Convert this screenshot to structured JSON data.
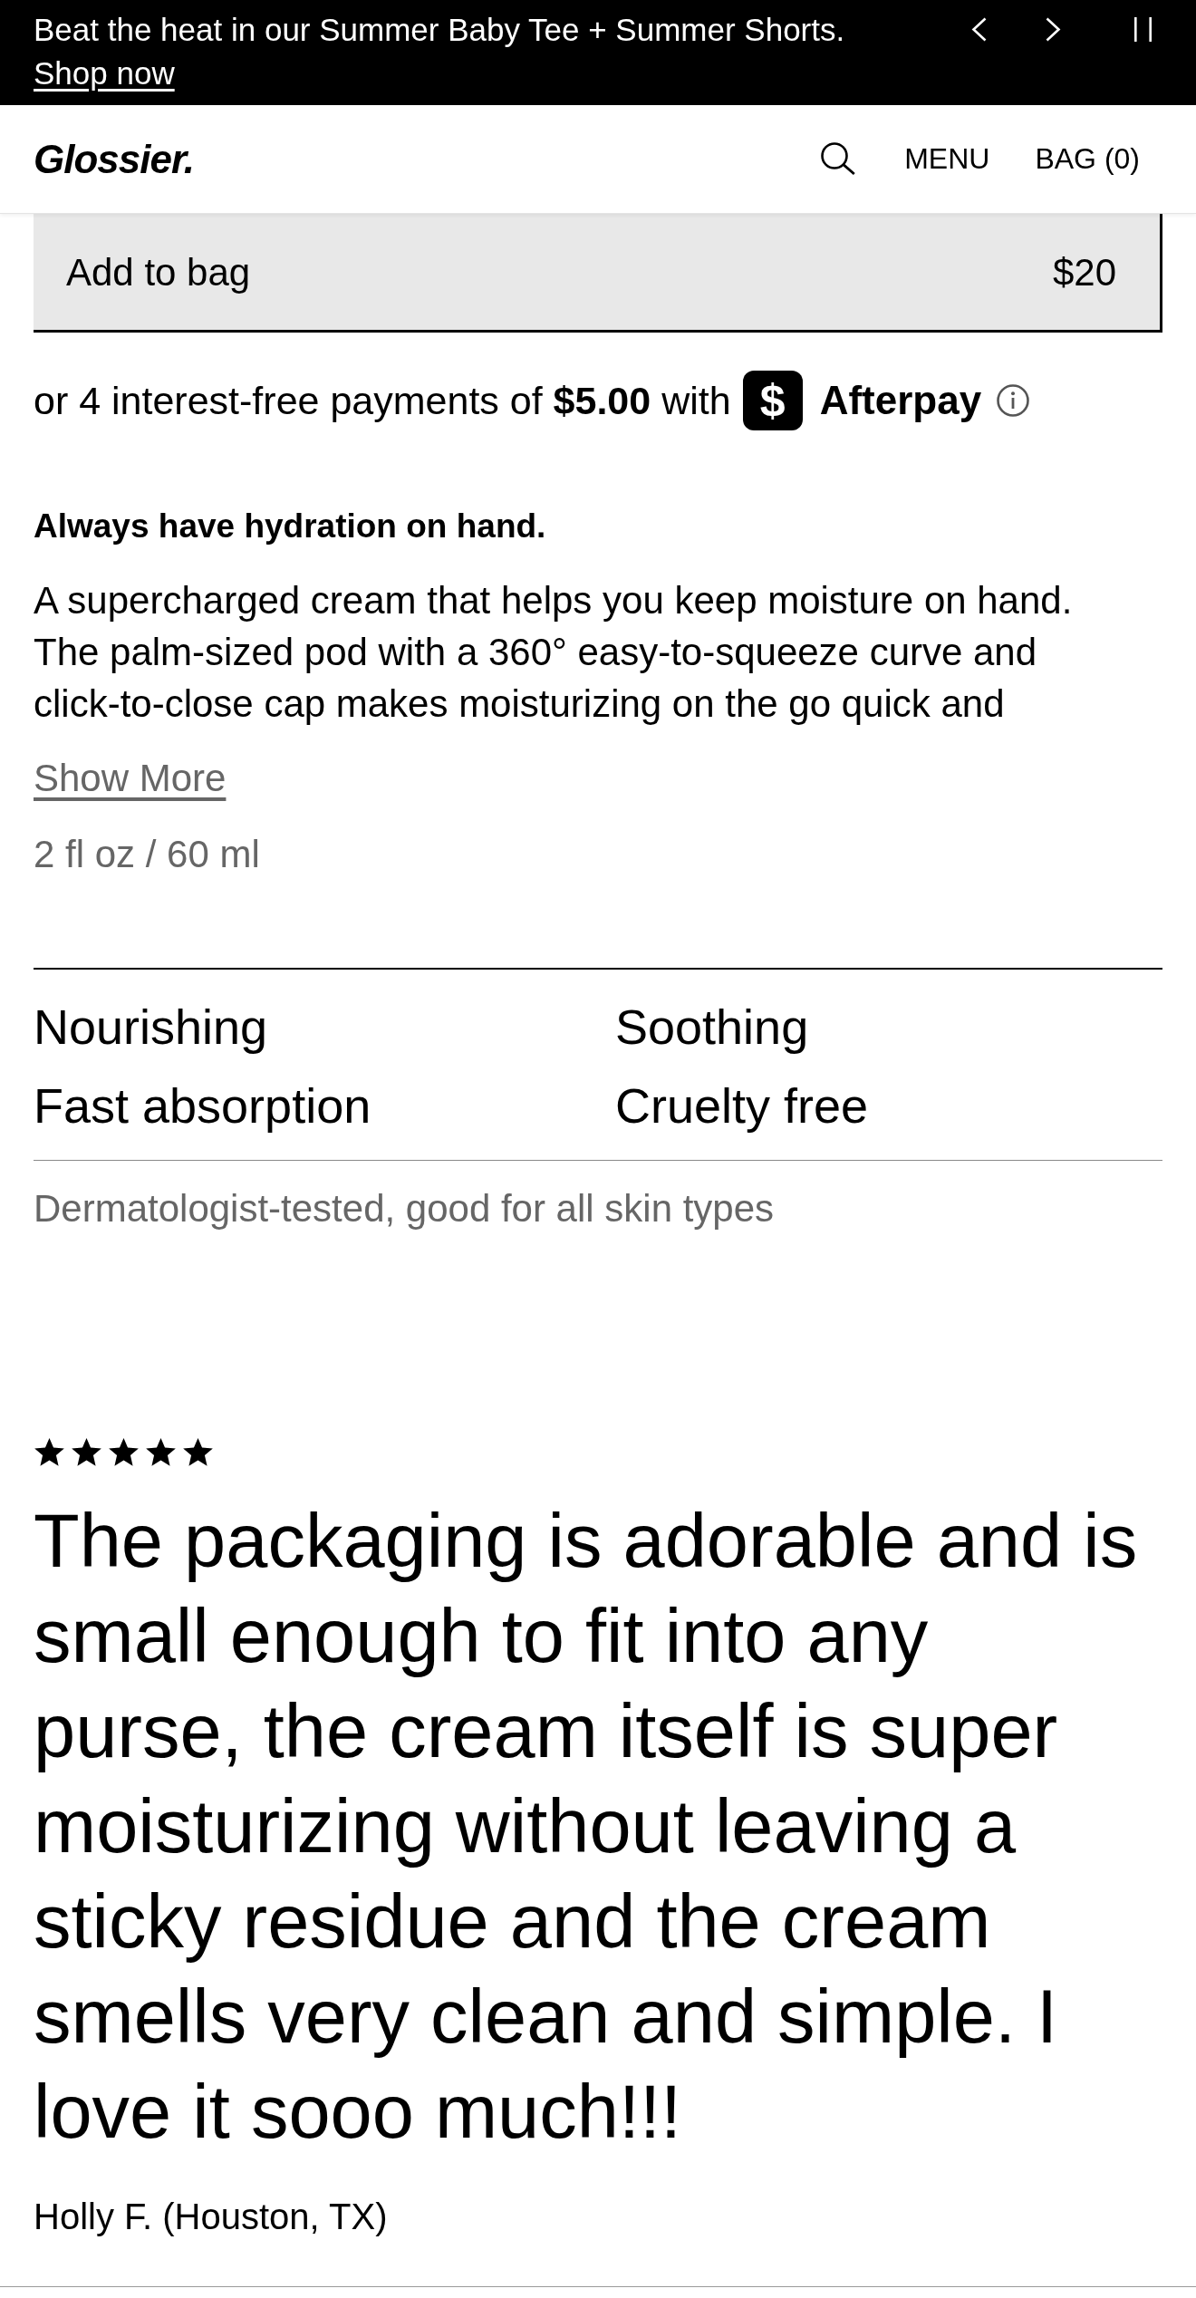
{
  "announcement": {
    "message": "Beat the heat in our Summer Baby Tee + Summer Shorts.",
    "link": "Shop now"
  },
  "header": {
    "logo": "Glossier.",
    "menu": "MENU",
    "bag": "BAG (0)"
  },
  "purchase": {
    "button_label": "Add to bag",
    "price": "$20"
  },
  "installments": {
    "text": "or 4 interest-free payments of **$5.00** with",
    "logo_glyph": "$",
    "provider": "Afterpay"
  },
  "description": {
    "heading": "Always have hydration on hand.",
    "body": "A supercharged cream that helps you keep moisture on hand. The palm-sized pod with a 360° easy-to-squeeze curve and click-to-close cap makes moisturizing on the go quick and",
    "show_more": "Show More",
    "size": "2 fl oz / 60 ml"
  },
  "benefits": {
    "items": [
      "Nourishing",
      "Soothing",
      "Fast absorption",
      "Cruelty free"
    ],
    "note": "Dermatologist-tested, good for all skin types"
  },
  "review": {
    "stars": 5,
    "quote": "The packaging is adorable and is small enough to fit into any purse, the cream itself is super moisturizing without leaving a sticky residue and the cream smells very clean and simple. I love it sooo much!!!",
    "author": "Holly F. (Houston, TX)"
  }
}
